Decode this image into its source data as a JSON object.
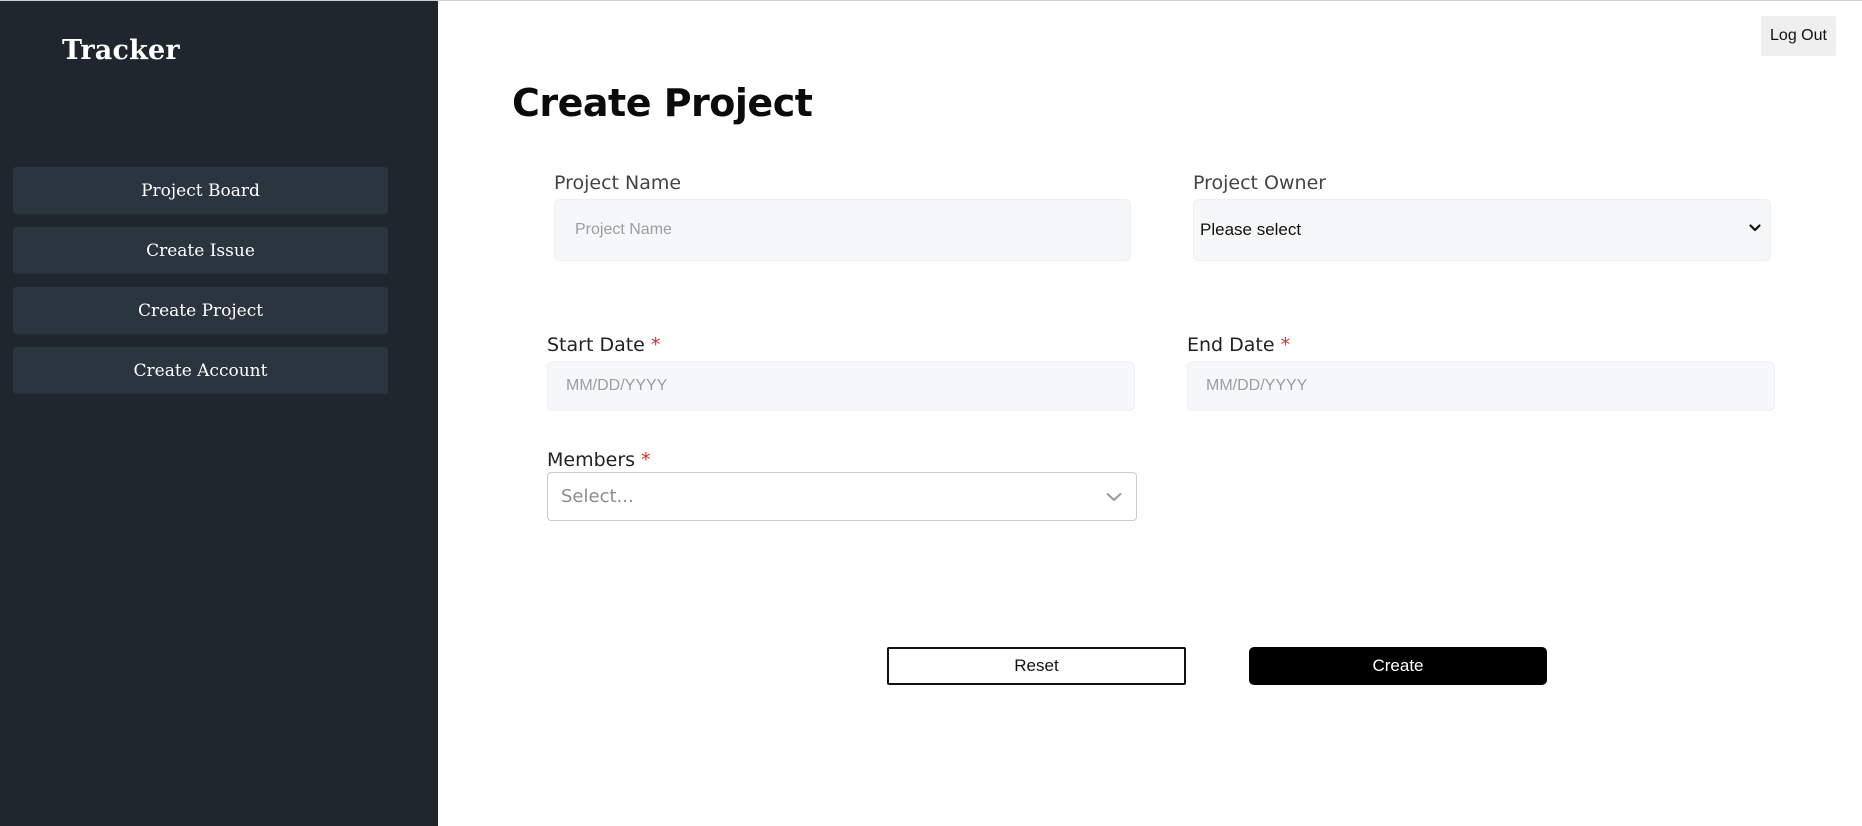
{
  "sidebar": {
    "brand": "Tracker",
    "items": [
      {
        "label": "Project Board"
      },
      {
        "label": "Create Issue"
      },
      {
        "label": "Create Project"
      },
      {
        "label": "Create Account"
      }
    ]
  },
  "header": {
    "logout_label": "Log Out"
  },
  "main": {
    "title": "Create Project",
    "form": {
      "project_name": {
        "label": "Project Name",
        "placeholder": "Project Name",
        "value": ""
      },
      "project_owner": {
        "label": "Project Owner",
        "selected": "Please select"
      },
      "start_date": {
        "label": "Start Date",
        "required_mark": "*",
        "placeholder": "MM/DD/YYYY"
      },
      "end_date": {
        "label": "End Date",
        "required_mark": "*",
        "placeholder": "MM/DD/YYYY"
      },
      "members": {
        "label": "Members",
        "required_mark": "*",
        "placeholder": "Select..."
      }
    },
    "actions": {
      "reset_label": "Reset",
      "create_label": "Create"
    }
  },
  "colors": {
    "sidebar_bg": "#20262d",
    "nav_item_bg": "#2b353f",
    "required": "#d32f2f",
    "primary_button": "#000000"
  },
  "icons": {
    "owner_dropdown": "chevron-down-icon",
    "members_dropdown": "chevron-down-icon"
  }
}
